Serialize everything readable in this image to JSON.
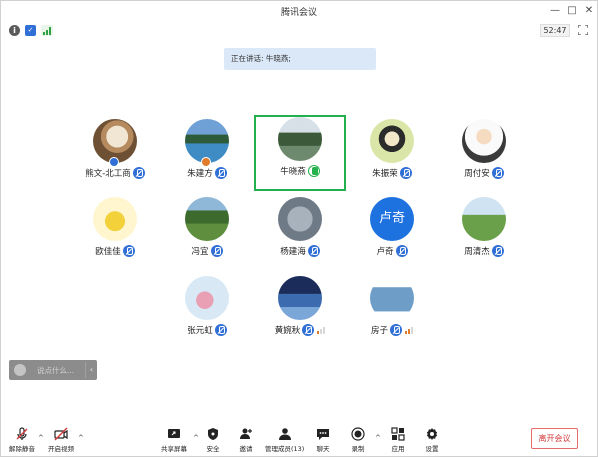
{
  "window": {
    "title": "腾讯会议"
  },
  "status": {
    "timer": "52:47"
  },
  "banner": {
    "speaking": "正在讲话: 牛晓燕;"
  },
  "participants": [
    {
      "name": "熊文-北工商",
      "mic": "muted",
      "badge": true
    },
    {
      "name": "朱建方",
      "mic": "muted",
      "badge": true
    },
    {
      "name": "牛晓燕",
      "mic": "speaking",
      "active": true
    },
    {
      "name": "朱振荣",
      "mic": "muted"
    },
    {
      "name": "周付安",
      "mic": "muted"
    },
    {
      "name": "欧佳佳",
      "mic": "muted"
    },
    {
      "name": "冯宜",
      "mic": "muted"
    },
    {
      "name": "杨建海",
      "mic": "muted"
    },
    {
      "name": "卢奇",
      "mic": "muted",
      "avatar_text": "卢奇"
    },
    {
      "name": "周清杰",
      "mic": "muted"
    },
    {
      "name": "张元虹",
      "mic": "muted"
    },
    {
      "name": "黄婉秋",
      "mic": "muted",
      "signal": true
    },
    {
      "name": "房子",
      "mic": "muted",
      "signal": true
    }
  ],
  "chat": {
    "placeholder": "说点什么..."
  },
  "toolbar": {
    "unmute": "解除静音",
    "video": "开启视频",
    "share": "共享屏幕",
    "security": "安全",
    "invite": "邀请",
    "members": "管理成员(13)",
    "chat": "聊天",
    "record": "录制",
    "apps": "应用",
    "settings": "设置",
    "end": "离开会议"
  },
  "colors": {
    "accent": "#2f6fd6",
    "active_border": "#22b14c",
    "danger": "#d23a3a"
  }
}
